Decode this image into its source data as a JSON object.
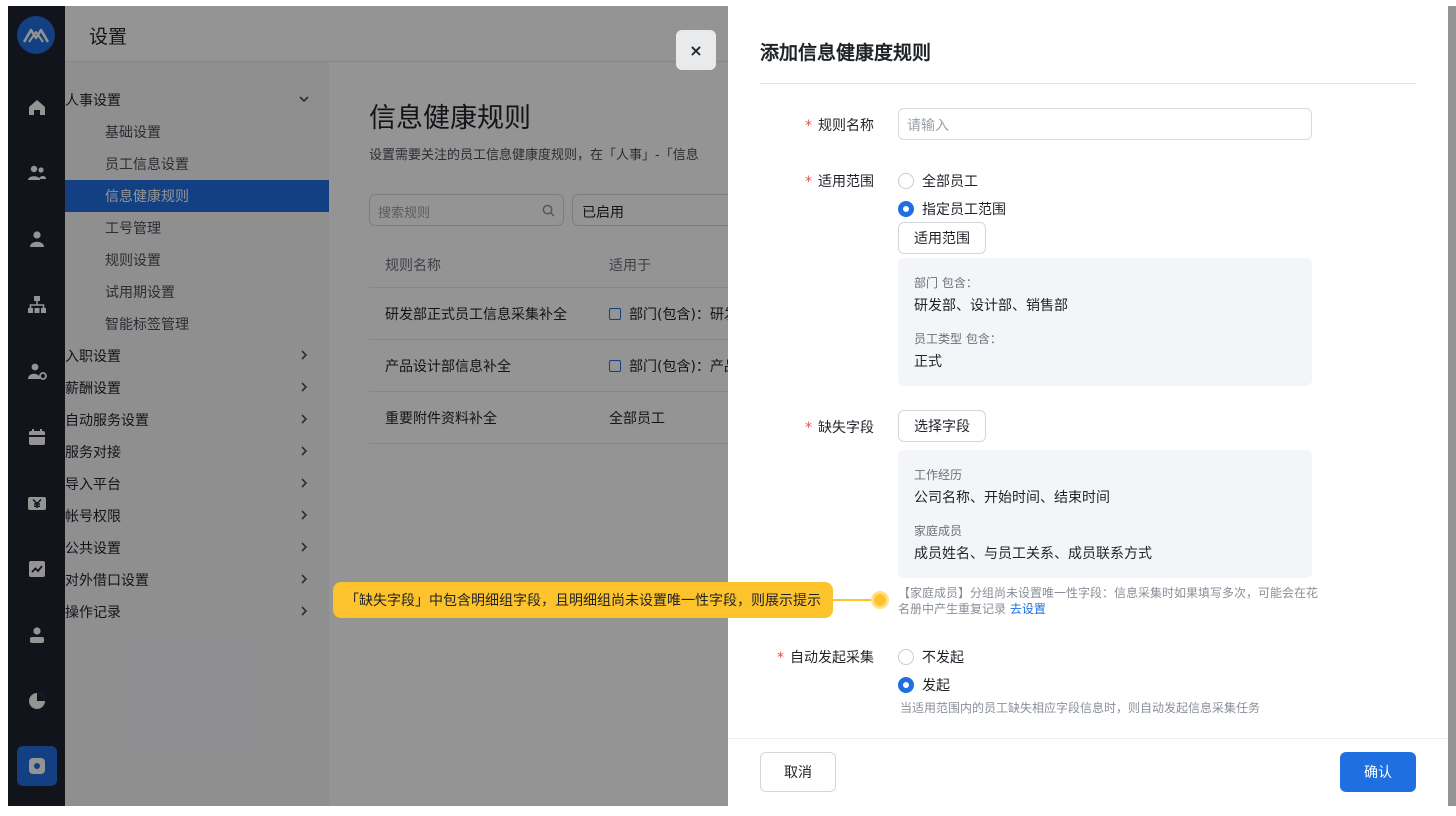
{
  "header": {
    "title": "设置"
  },
  "nav": {
    "items": [
      {
        "label": "人事设置",
        "type": "group",
        "expanded": true
      },
      {
        "label": "基础设置",
        "type": "sub"
      },
      {
        "label": "员工信息设置",
        "type": "sub"
      },
      {
        "label": "信息健康规则",
        "type": "sub",
        "active": true
      },
      {
        "label": "工号管理",
        "type": "sub"
      },
      {
        "label": "规则设置",
        "type": "sub"
      },
      {
        "label": "试用期设置",
        "type": "sub"
      },
      {
        "label": "智能标签管理",
        "type": "sub"
      },
      {
        "label": "入职设置",
        "type": "group"
      },
      {
        "label": "薪酬设置",
        "type": "group"
      },
      {
        "label": "自动服务设置",
        "type": "group"
      },
      {
        "label": "服务对接",
        "type": "group"
      },
      {
        "label": "导入平台",
        "type": "group"
      },
      {
        "label": "帐号权限",
        "type": "group"
      },
      {
        "label": "公共设置",
        "type": "group"
      },
      {
        "label": "对外借口设置",
        "type": "group"
      },
      {
        "label": "操作记录",
        "type": "group"
      }
    ]
  },
  "main": {
    "title": "信息健康规则",
    "description": "设置需要关注的员工信息健康度规则，在「人事」-「信息",
    "search_placeholder": "搜索规则",
    "status_filter": "已启用",
    "columns": [
      "规则名称",
      "适用于"
    ],
    "rows": [
      {
        "name": "研发部正式员工信息采集补全",
        "scope": "部门(包含)：研发",
        "has_icon": true
      },
      {
        "name": "产品设计部信息补全",
        "scope": "部门(包含)：产品",
        "has_icon": true
      },
      {
        "name": "重要附件资料补全",
        "scope": "全部员工",
        "has_icon": false
      }
    ]
  },
  "close_symbol": "×",
  "drawer": {
    "title": "添加信息健康度规则",
    "required_mark": "*",
    "rule_name": {
      "label": "规则名称",
      "placeholder": "请输入"
    },
    "scope": {
      "label": "适用范围",
      "options": [
        {
          "label": "全部员工",
          "selected": false
        },
        {
          "label": "指定员工范围",
          "selected": true
        }
      ],
      "button": "适用范围",
      "summary": [
        {
          "key": "部门 包含：",
          "value": "研发部、设计部、销售部"
        },
        {
          "key": "员工类型 包含：",
          "value": "正式"
        }
      ]
    },
    "missing_fields": {
      "label": "缺失字段",
      "button": "选择字段",
      "summary": [
        {
          "key": "工作经历",
          "value": "公司名称、开始时间、结束时间"
        },
        {
          "key": "家庭成员",
          "value": "成员姓名、与员工关系、成员联系方式"
        }
      ],
      "warning": "【家庭成员】分组尚未设置唯一性字段：信息采集时如果填写多次，可能会在花名册中产生重复记录",
      "warning_link": "去设置"
    },
    "auto_collect": {
      "label": "自动发起采集",
      "options": [
        {
          "label": "不发起",
          "selected": false
        },
        {
          "label": "发起",
          "selected": true
        }
      ],
      "hint": "当适用范围内的员工缺失相应字段信息时，则自动发起信息采集任务"
    },
    "cancel_label": "取消",
    "confirm_label": "确认"
  },
  "annotation": {
    "text": "「缺失字段」中包含明细组字段，且明细组尚未设置唯一性字段，则展示提示"
  },
  "colors": {
    "primary": "#1f6fe0",
    "rail_bg": "#1f2330",
    "required": "#f54a45",
    "callout": "#fdc32c"
  },
  "icons": {
    "rail": [
      "home-icon",
      "team-icon",
      "person-icon",
      "org-chart-icon",
      "person-settings-icon",
      "calendar-icon",
      "yen-icon",
      "chart-trend-icon",
      "person-badge-icon",
      "pie-chart-icon",
      "settings-icon"
    ]
  }
}
